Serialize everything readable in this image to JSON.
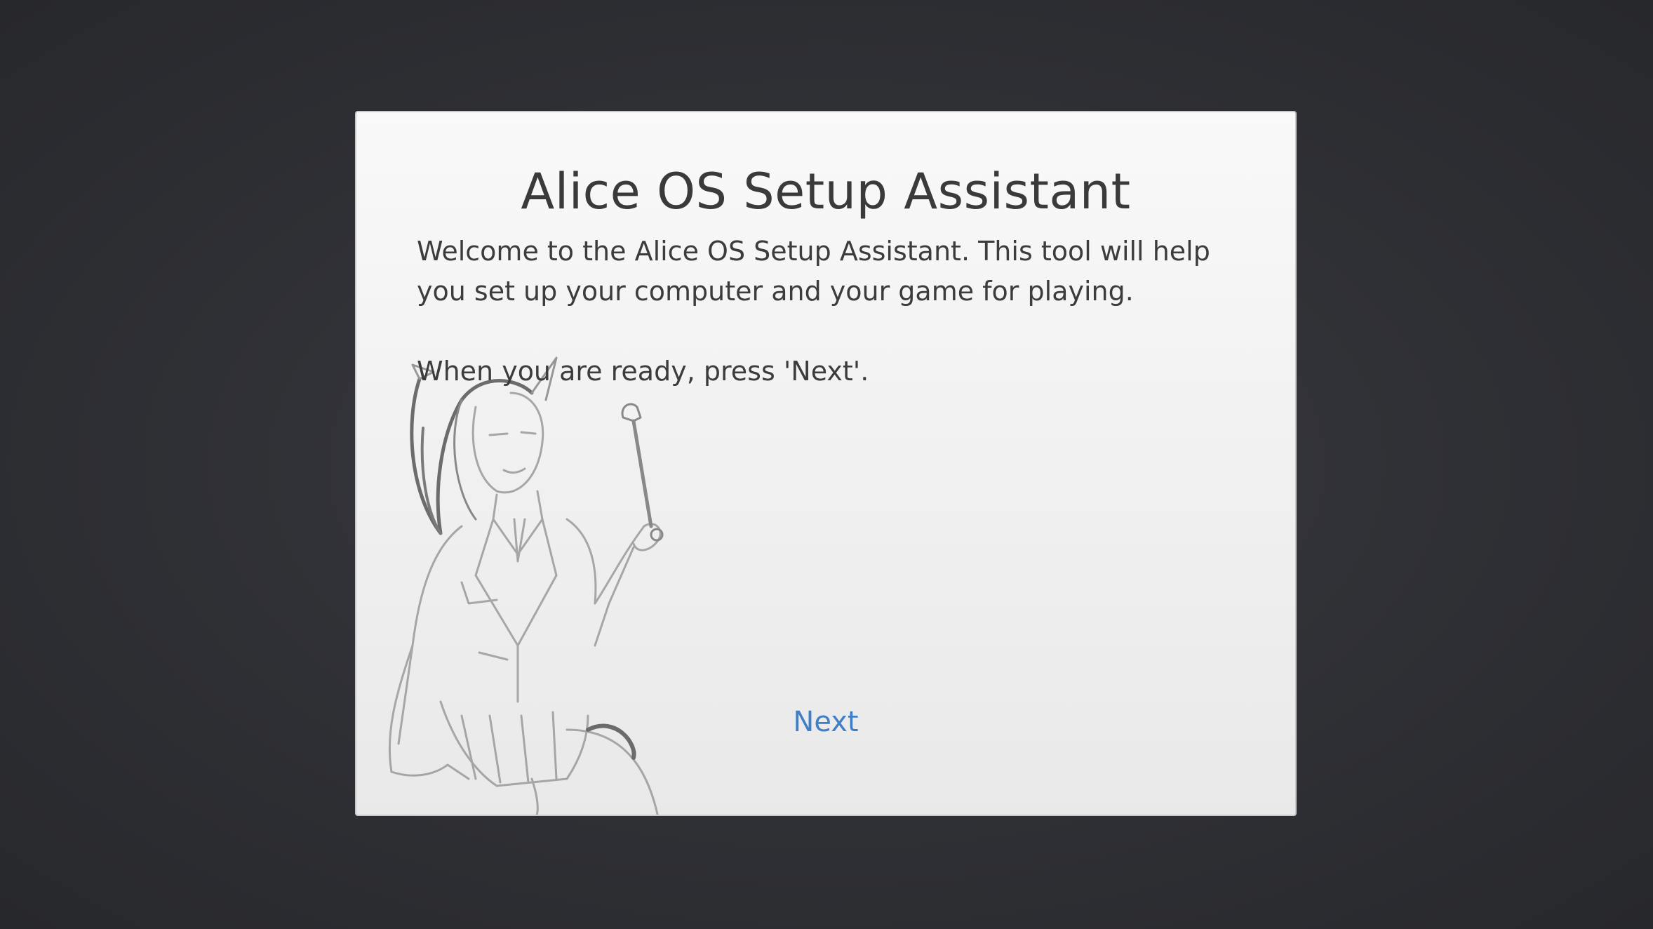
{
  "dialog": {
    "title": "Alice OS Setup Assistant",
    "paragraph_1": "Welcome to the Alice OS Setup Assistant. This tool will help you set up your computer and your game for playing.",
    "paragraph_2": "When you are ready, press 'Next'.",
    "next_label": "Next",
    "illustration_icon": "girl-with-wrench-sketch-icon"
  },
  "colors": {
    "background": "#2f3035",
    "dialog_background": "#f4f4f4",
    "text": "#3a3a3a",
    "link": "#3f7fc8"
  }
}
